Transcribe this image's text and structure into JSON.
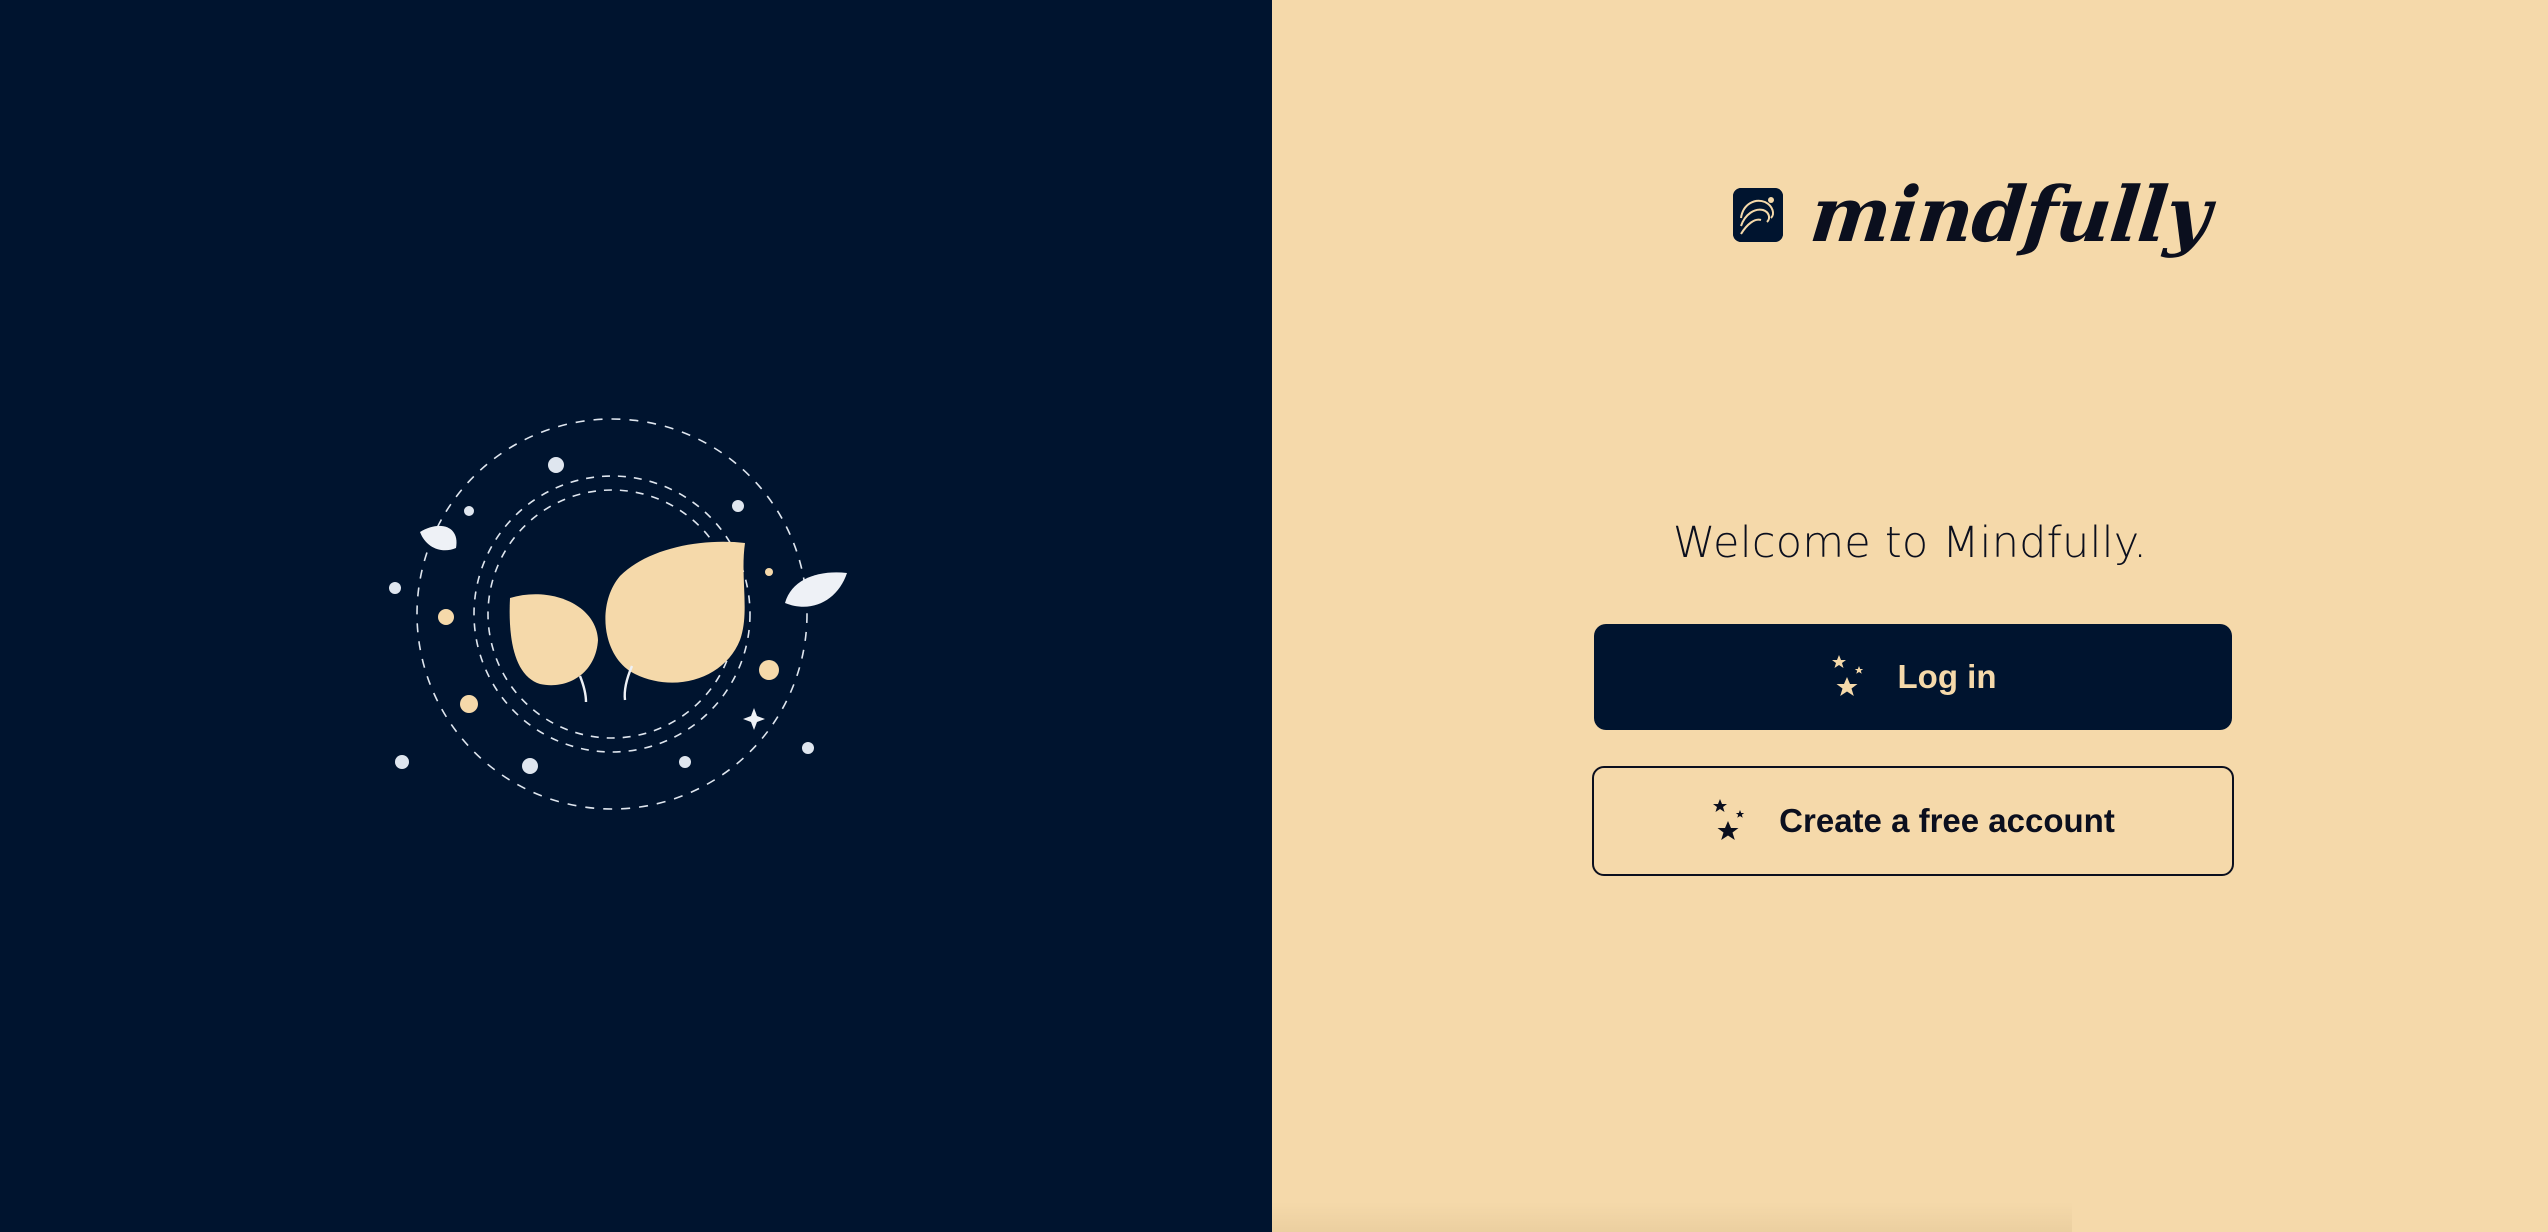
{
  "brand": {
    "name": "mindfully",
    "logo_icon": "waves-logo-icon"
  },
  "welcome": {
    "text": "Welcome to Mindfully."
  },
  "actions": {
    "login_label": "Log in",
    "login_icon": "sparkle-stars-icon",
    "create_label": "Create a free account",
    "create_icon": "sparkle-stars-icon"
  },
  "illustration": {
    "name": "leaves-orbit-illustration"
  },
  "colors": {
    "navy": "#00142f",
    "cream": "#f5d9aa",
    "ink": "#0b0f1e",
    "leaf_white": "#eef1f6"
  }
}
